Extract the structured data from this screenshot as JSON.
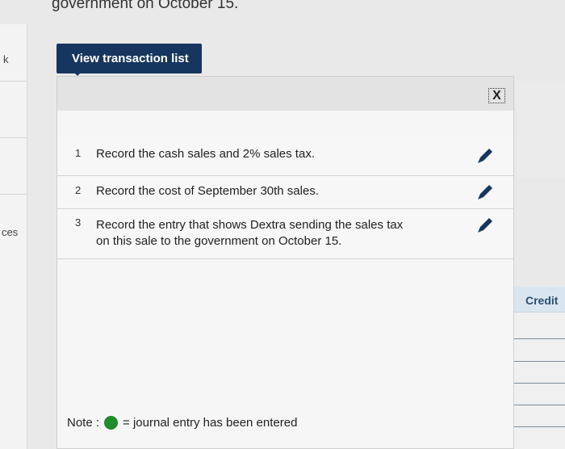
{
  "page": {
    "heading_fragment": "government on October 15.",
    "left_labels": [
      "k",
      "ces"
    ],
    "credit_header": "Credit"
  },
  "popup": {
    "button_label": "View transaction list",
    "close_symbol": "X",
    "tasks": [
      {
        "num": "1",
        "text": "Record the cash sales and 2% sales tax."
      },
      {
        "num": "2",
        "text": "Record the cost of September 30th sales."
      },
      {
        "num": "3",
        "text_line1": "Record the entry that shows Dextra sending the sales tax",
        "text_line2": "on this sale to the government on October 15."
      }
    ],
    "note_label": "Note :",
    "note_text": "= journal entry has been entered",
    "edit_icon": "pencil-icon",
    "status_color": "#1e8c2a",
    "accent_color": "#17365f"
  }
}
